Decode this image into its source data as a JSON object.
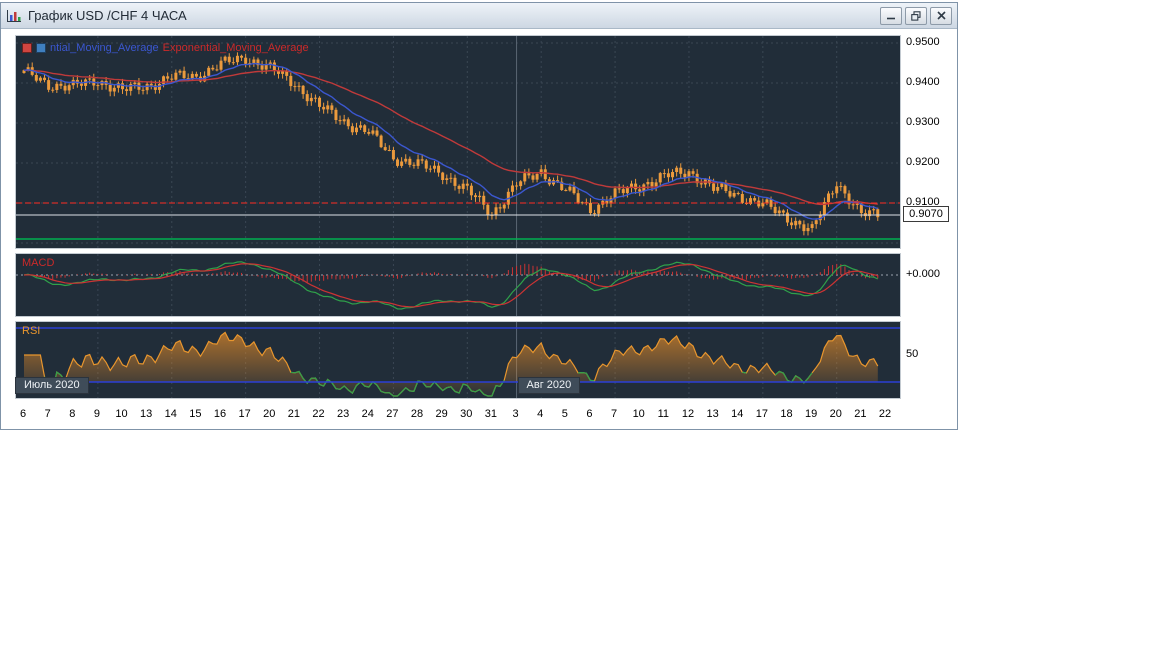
{
  "window": {
    "title": "График USD /CHF  4 ЧАСА"
  },
  "legend": {
    "ema_blue": "ntial_Moving_Average",
    "ema_red": "Exponential_Moving_Average",
    "macd": "MACD",
    "rsi": "RSI"
  },
  "price_axis": {
    "labels": [
      "0.9500",
      "0.9400",
      "0.9300",
      "0.9200",
      "0.9100"
    ],
    "current_price": "0.9070",
    "macd_zero": "+0.000",
    "rsi_mid": "50"
  },
  "time_axis": {
    "ticks": [
      "6",
      "7",
      "8",
      "9",
      "10",
      "13",
      "14",
      "15",
      "16",
      "17",
      "20",
      "21",
      "22",
      "23",
      "24",
      "27",
      "28",
      "29",
      "30",
      "31",
      "3",
      "4",
      "5",
      "6",
      "7",
      "10",
      "11",
      "12",
      "13",
      "14",
      "17",
      "18",
      "19",
      "20",
      "21",
      "22"
    ],
    "month_badges": [
      {
        "label": "Июль 2020",
        "tick_index": 0
      },
      {
        "label": "Авг 2020",
        "tick_index": 20
      }
    ]
  },
  "chart_data": {
    "type": "candlestick",
    "symbol": "USD/CHF",
    "timeframe": "4 hours",
    "price_axis_range": [
      0.8983,
      0.9518
    ],
    "price_gridlines": [
      0.95,
      0.94,
      0.93,
      0.92,
      0.91,
      0.9
    ],
    "daily_closes": [
      {
        "day": "6",
        "close": 0.9425
      },
      {
        "day": "7",
        "close": 0.9398
      },
      {
        "day": "8",
        "close": 0.939
      },
      {
        "day": "9",
        "close": 0.9408
      },
      {
        "day": "10",
        "close": 0.938
      },
      {
        "day": "13",
        "close": 0.9395
      },
      {
        "day": "14",
        "close": 0.9412
      },
      {
        "day": "15",
        "close": 0.9418
      },
      {
        "day": "16",
        "close": 0.9445
      },
      {
        "day": "17",
        "close": 0.9465
      },
      {
        "day": "20",
        "close": 0.9435
      },
      {
        "day": "21",
        "close": 0.94
      },
      {
        "day": "22",
        "close": 0.934
      },
      {
        "day": "23",
        "close": 0.9305
      },
      {
        "day": "24",
        "close": 0.9275
      },
      {
        "day": "27",
        "close": 0.9215
      },
      {
        "day": "28",
        "close": 0.9195
      },
      {
        "day": "29",
        "close": 0.9175
      },
      {
        "day": "30",
        "close": 0.913
      },
      {
        "day": "31",
        "close": 0.9075
      },
      {
        "day": "3",
        "close": 0.9145
      },
      {
        "day": "4",
        "close": 0.918
      },
      {
        "day": "5",
        "close": 0.913
      },
      {
        "day": "6",
        "close": 0.9085
      },
      {
        "day": "7",
        "close": 0.912
      },
      {
        "day": "10",
        "close": 0.9145
      },
      {
        "day": "11",
        "close": 0.9165
      },
      {
        "day": "12",
        "close": 0.918
      },
      {
        "day": "13",
        "close": 0.9135
      },
      {
        "day": "14",
        "close": 0.912
      },
      {
        "day": "17",
        "close": 0.9095
      },
      {
        "day": "18",
        "close": 0.9065
      },
      {
        "day": "19",
        "close": 0.903
      },
      {
        "day": "20",
        "close": 0.9155
      },
      {
        "day": "21",
        "close": 0.907
      },
      {
        "day": "22",
        "close": 0.907
      }
    ],
    "levels": {
      "dashed_red_line": 0.91,
      "white_line_current": 0.907,
      "green_support_line": 0.901
    },
    "macd_zero_value": 0.0,
    "rsi_levels": [
      70,
      30
    ],
    "colors": {
      "panel_background": "#212d39",
      "grid": "#3a4754",
      "candle": "#eb9a3d",
      "ema_fast_blue": "#3b57d0",
      "ema_slow_red": "#c03a3a",
      "macd_line_green": "#2fa14a",
      "macd_signal_red": "#cc3333",
      "macd_histogram": "#cc3333",
      "rsi_line": "#e8962e",
      "rsi_level_blue": "#2b3fd6",
      "level_red": "#ff2d23",
      "level_white": "#dde1e6",
      "level_green": "#00b050",
      "month_separator": "#5a6673"
    }
  }
}
